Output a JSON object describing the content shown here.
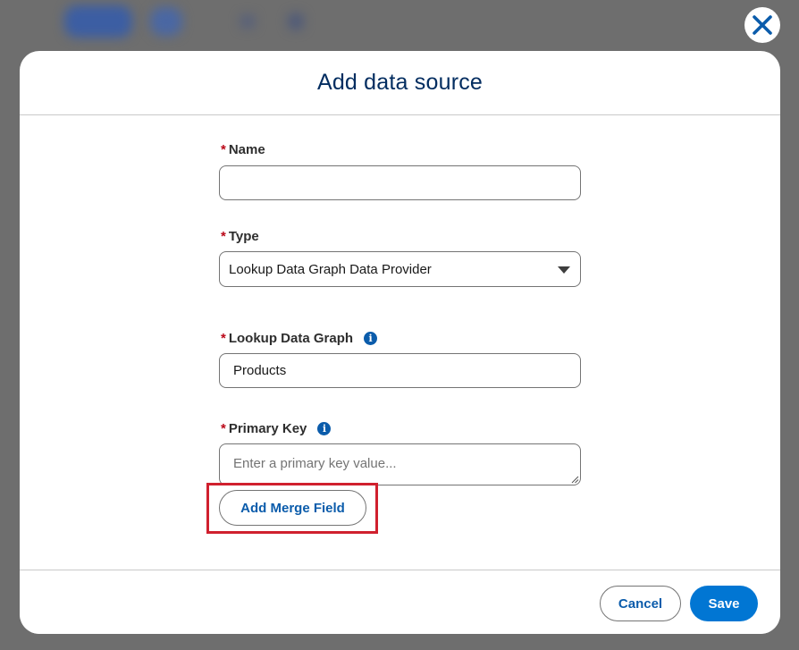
{
  "modal": {
    "title": "Add data source",
    "close_icon": "close-icon"
  },
  "form": {
    "required_marker": "*",
    "name": {
      "label": "Name",
      "value": ""
    },
    "type": {
      "label": "Type",
      "selected": "Lookup Data Graph Data Provider"
    },
    "lookup_data_graph": {
      "label": "Lookup Data Graph",
      "value": "Products",
      "info_icon": "info-icon"
    },
    "primary_key": {
      "label": "Primary Key",
      "placeholder": "Enter a primary key value...",
      "info_icon": "info-icon"
    },
    "add_merge_field_label": "Add Merge Field"
  },
  "footer": {
    "cancel_label": "Cancel",
    "save_label": "Save"
  },
  "colors": {
    "brand_blue": "#0176d3",
    "link_blue": "#0b5cab",
    "title_navy": "#032d60",
    "required_red": "#ba0517",
    "highlight_red": "#d0202e"
  }
}
